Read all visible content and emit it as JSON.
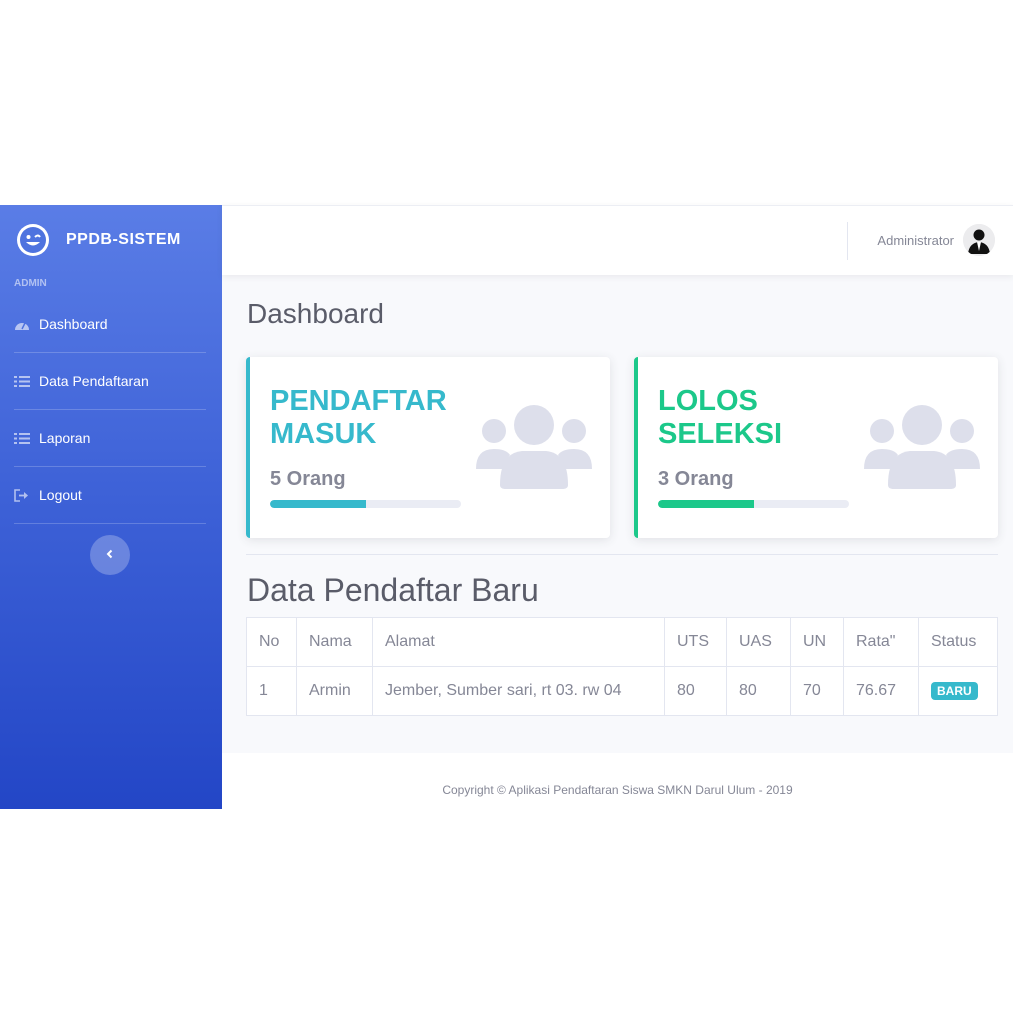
{
  "brand": {
    "title": "PPDB-SISTEM",
    "logo_icon": "laugh-wink-icon"
  },
  "sidebar": {
    "section_label": "ADMIN",
    "items": [
      {
        "label": "Dashboard",
        "icon": "tachometer-icon"
      },
      {
        "label": "Data Pendaftaran",
        "icon": "list-icon"
      },
      {
        "label": "Laporan",
        "icon": "list-icon"
      },
      {
        "label": "Logout",
        "icon": "sign-out-icon"
      }
    ],
    "toggle_icon": "chevron-left-icon"
  },
  "topbar": {
    "user_name": "Administrator"
  },
  "page": {
    "title": "Dashboard"
  },
  "cards": [
    {
      "title": "PENDAFTAR MASUK",
      "count": "5 Orang",
      "progress": 0.5,
      "color": "#36b9cc",
      "icon": "users-icon"
    },
    {
      "title": "LOLOS SELEKSI",
      "count": "3 Orang",
      "progress": 0.5,
      "color": "#1cc88a",
      "icon": "users-icon"
    }
  ],
  "table": {
    "title": "Data Pendaftar Baru",
    "headers": [
      "No",
      "Nama",
      "Alamat",
      "UTS",
      "UAS",
      "UN",
      "Rata\"",
      "Status"
    ],
    "rows": [
      [
        "1",
        "Armin",
        "Jember, Sumber sari, rt 03. rw 04",
        "80",
        "80",
        "70",
        "76.67",
        "BARU"
      ]
    ]
  },
  "footer": {
    "text": "Copyright © Aplikasi Pendaftaran Siswa SMKN Darul Ulum - 2019"
  },
  "colors": {
    "primary": "#4e73df",
    "info": "#36b9cc",
    "success": "#1cc88a",
    "text": "#858796"
  }
}
